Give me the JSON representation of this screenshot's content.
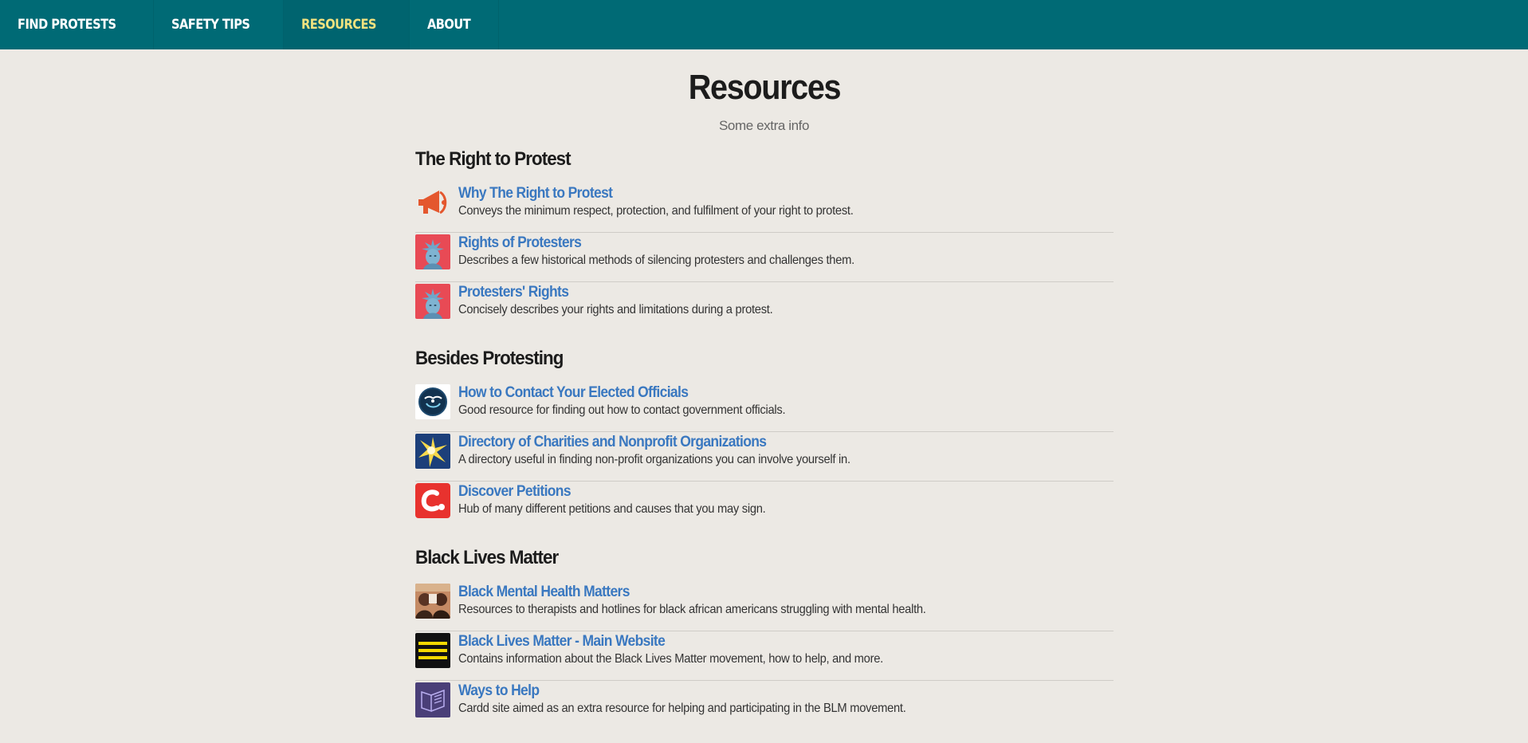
{
  "nav": {
    "items": [
      {
        "label": "FIND PROTESTS",
        "active": false
      },
      {
        "label": "SAFETY TIPS",
        "active": false
      },
      {
        "label": "RESOURCES",
        "active": true
      },
      {
        "label": "ABOUT",
        "active": false
      }
    ]
  },
  "header": {
    "title": "Resources",
    "subtitle": "Some extra info"
  },
  "sections": [
    {
      "title": "The Right to Protest",
      "items": [
        {
          "icon": "megaphone-icon",
          "title": "Why The Right to Protest",
          "desc": "Conveys the minimum respect, protection, and fulfilment of your right to protest."
        },
        {
          "icon": "statue-of-liberty-icon",
          "title": "Rights of Protesters",
          "desc": "Describes a few historical methods of silencing protesters and challenges them."
        },
        {
          "icon": "statue-of-liberty-icon",
          "title": "Protesters' Rights",
          "desc": "Concisely describes your rights and limitations during a protest."
        }
      ]
    },
    {
      "title": "Besides Protesting",
      "items": [
        {
          "icon": "usagov-logo-icon",
          "title": "How to Contact Your Elected Officials",
          "desc": "Good resource for finding out how to contact government officials."
        },
        {
          "icon": "star-burst-icon",
          "title": "Directory of Charities and Nonprofit Organizations",
          "desc": "A directory useful in finding non-profit organizations you can involve yourself in."
        },
        {
          "icon": "change-org-logo-icon",
          "title": "Discover Petitions",
          "desc": "Hub of many different petitions and causes that you may sign."
        }
      ]
    },
    {
      "title": "Black Lives Matter",
      "items": [
        {
          "icon": "people-photo-icon",
          "title": "Black Mental Health Matters",
          "desc": "Resources to therapists and hotlines for black african americans struggling with mental health."
        },
        {
          "icon": "menu-lines-icon",
          "title": "Black Lives Matter - Main Website",
          "desc": "Contains information about the Black Lives Matter movement, how to help, and more."
        },
        {
          "icon": "open-book-icon",
          "title": "Ways to Help",
          "desc": "Cardd site aimed as an extra resource for helping and participating in the BLM movement."
        }
      ]
    }
  ],
  "colors": {
    "navbar": "#006a75",
    "nav_active_text": "#f2e27f",
    "background": "#ece9e4",
    "link": "#3a78c0"
  }
}
